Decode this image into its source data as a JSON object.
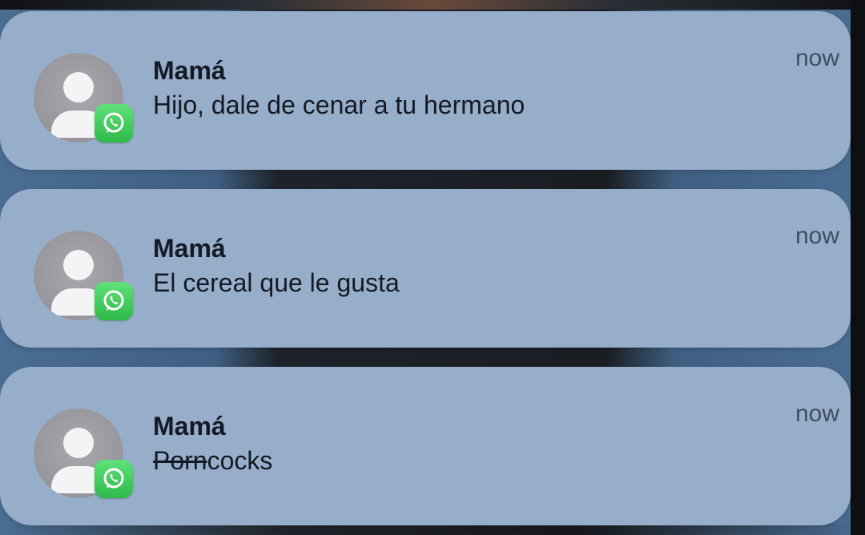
{
  "notifications": [
    {
      "sender": "Mamá",
      "message": "Hijo, dale de cenar a tu hermano",
      "time": "now",
      "app_icon": "whatsapp-icon"
    },
    {
      "sender": "Mamá",
      "message": "El cereal que le gusta",
      "time": "now",
      "app_icon": "whatsapp-icon"
    },
    {
      "sender": "Mamá",
      "message_struck": "Porn",
      "message": "cocks",
      "time": "now",
      "app_icon": "whatsapp-icon"
    }
  ],
  "colors": {
    "card_background": "#97aecb",
    "whatsapp_green": "#2fb94a",
    "text_primary": "#141a24",
    "text_secondary": "#3f4e62"
  }
}
